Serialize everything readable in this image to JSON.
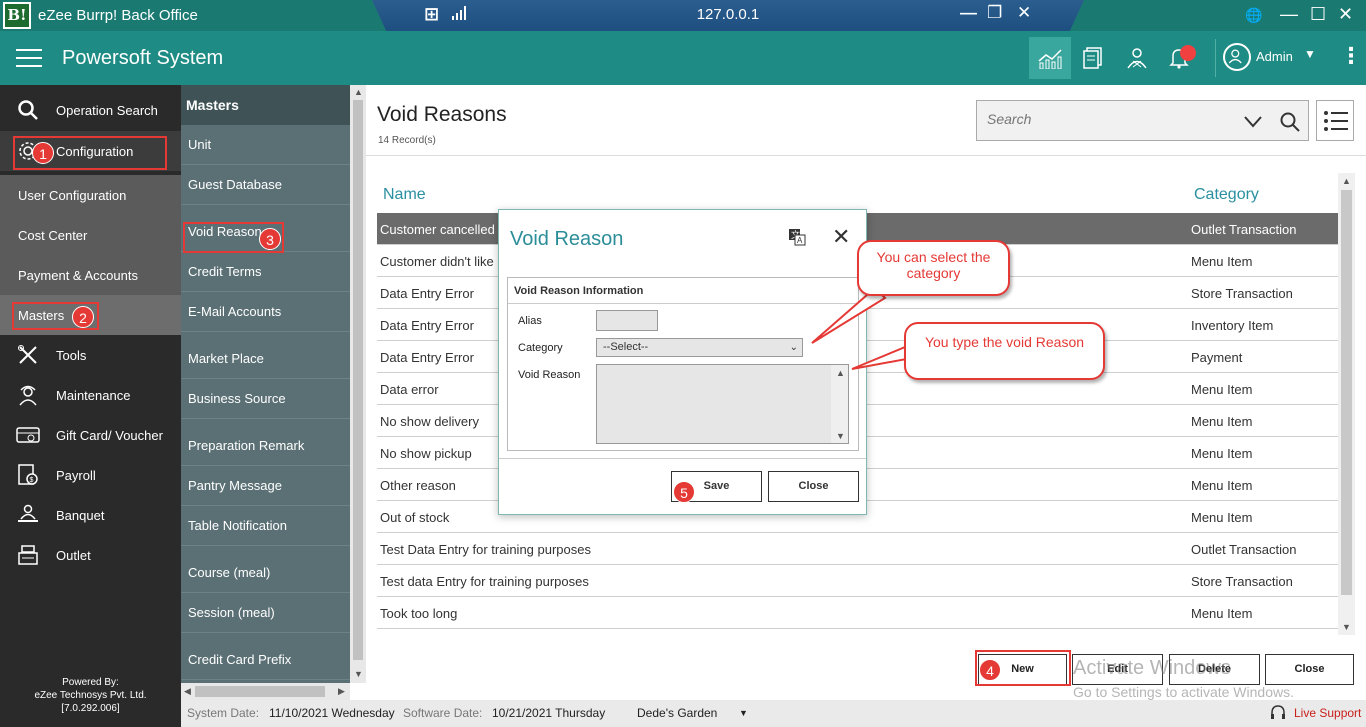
{
  "titlebar": {
    "logo_text": "B!",
    "app_title": "eZee Burrp! Back Office",
    "remote_ip": "127.0.0.1"
  },
  "header": {
    "brand": "Powersoft System",
    "user": "Admin"
  },
  "sidebar": {
    "items": [
      {
        "label": "Operation Search",
        "icon": "search-icon"
      },
      {
        "label": "Configuration",
        "icon": "gear-icon"
      },
      {
        "label": "User Configuration"
      },
      {
        "label": "Cost Center"
      },
      {
        "label": "Payment & Accounts"
      },
      {
        "label": "Masters"
      },
      {
        "label": "Tools",
        "icon": "tools-icon"
      },
      {
        "label": "Maintenance",
        "icon": "worker-icon"
      },
      {
        "label": "Gift Card/ Voucher",
        "icon": "giftcard-icon"
      },
      {
        "label": "Payroll",
        "icon": "payroll-icon"
      },
      {
        "label": "Banquet",
        "icon": "banquet-icon"
      },
      {
        "label": "Outlet",
        "icon": "register-icon"
      }
    ],
    "powered_by": "Powered By:",
    "company": "eZee Technosys Pvt. Ltd.",
    "version": "[7.0.292.006]"
  },
  "masters": {
    "heading": "Masters",
    "items": [
      "Unit",
      "Guest Database",
      "Void Reason",
      "Credit Terms",
      "E-Mail Accounts",
      "Market Place",
      "Business Source",
      "Preparation Remark",
      "Pantry Message",
      "Table Notification",
      "Course (meal)",
      "Session (meal)",
      "Credit Card Prefix"
    ]
  },
  "main": {
    "title": "Void Reasons",
    "records": "14 Record(s)",
    "search_placeholder": "Search",
    "columns": {
      "name": "Name",
      "category": "Category"
    },
    "rows": [
      {
        "name": "Customer cancelled",
        "category": "Outlet Transaction"
      },
      {
        "name": "Customer didn't like",
        "category": "Menu Item"
      },
      {
        "name": "Data Entry Error",
        "category": "Store Transaction"
      },
      {
        "name": "Data Entry Error",
        "category": "Inventory Item"
      },
      {
        "name": "Data Entry Error",
        "category": "Payment"
      },
      {
        "name": "Data error",
        "category": "Menu Item"
      },
      {
        "name": "No show delivery",
        "category": "Menu Item"
      },
      {
        "name": "No show pickup",
        "category": "Menu Item"
      },
      {
        "name": "Other reason",
        "category": "Menu Item"
      },
      {
        "name": "Out of stock",
        "category": "Menu Item"
      },
      {
        "name": "Test Data Entry for training purposes",
        "category": "Outlet Transaction"
      },
      {
        "name": "Test data Entry for training purposes",
        "category": "Store Transaction"
      },
      {
        "name": "Took too long",
        "category": "Menu Item"
      }
    ],
    "buttons": {
      "new": "New",
      "edit": "Edit",
      "delete": "Delete",
      "close": "Close"
    }
  },
  "dialog": {
    "title": "Void Reason",
    "section": "Void Reason Information",
    "alias_label": "Alias",
    "category_label": "Category",
    "category_value": "--Select--",
    "void_reason_label": "Void Reason",
    "save": "Save",
    "close": "Close"
  },
  "annotations": {
    "callout_category": "You can select the category",
    "callout_reason": "You type the void Reason",
    "steps": [
      "1",
      "2",
      "3",
      "4",
      "5"
    ]
  },
  "status": {
    "system_date_label": "System Date:",
    "system_date": "11/10/2021 Wednesday",
    "software_date_label": "Software Date:",
    "software_date": "10/21/2021 Thursday",
    "property": "Dede's Garden",
    "live_support": "Live Support"
  },
  "watermark": {
    "line1": "Activate Windows",
    "line2": "Go to Settings to activate Windows."
  },
  "colors": {
    "accent": "#1e8c84",
    "annotation": "#e53935",
    "dialog_title": "#2b8d98"
  }
}
